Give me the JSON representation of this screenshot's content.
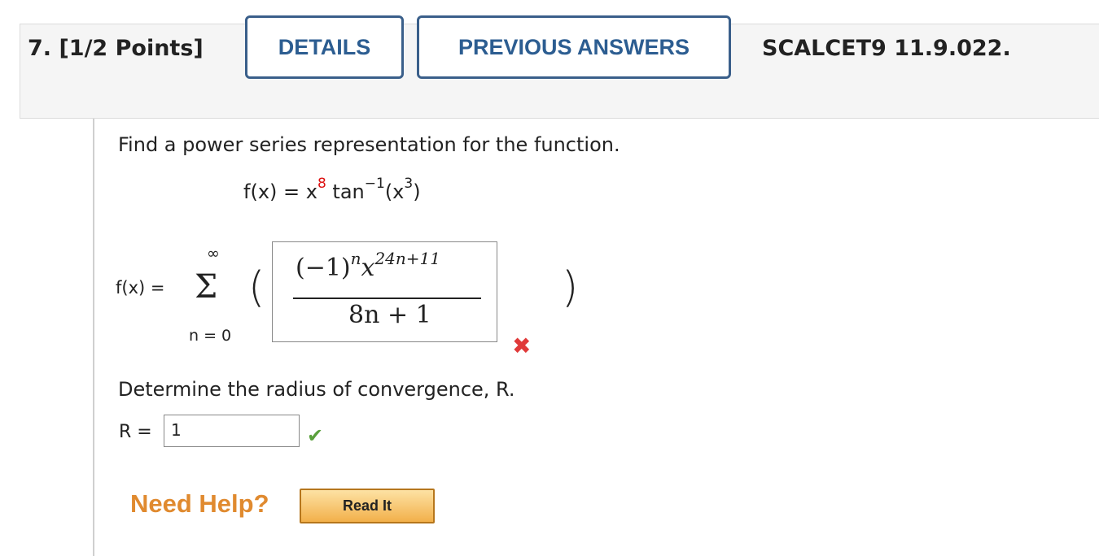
{
  "question": {
    "number_label": "7. [1/2 Points]",
    "details_button": "DETAILS",
    "previous_answers_button": "PREVIOUS ANSWERS",
    "code": "SCALCET9 11.9.022."
  },
  "problem": {
    "prompt": "Find a power series representation for the function.",
    "function_prefix": "f(x) = x",
    "function_exponent": "8",
    "function_tan": "tan",
    "function_tan_exp": "−1",
    "function_arg": "(x",
    "function_arg_exp": "3",
    "function_close": ")"
  },
  "series": {
    "lhs": "f(x) =",
    "upper_limit": "∞",
    "sigma": "Σ",
    "lower_limit": "n = 0",
    "answer_numerator_base": "(−1)",
    "answer_numerator_n": "n",
    "answer_numerator_x": "x",
    "answer_numerator_exp": "24n+11",
    "answer_denominator": "8n + 1",
    "status": "incorrect"
  },
  "radius": {
    "prompt": "Determine the radius of convergence, R.",
    "label": "R =",
    "value": "1",
    "status": "correct"
  },
  "help": {
    "label": "Need Help?",
    "read_it_button": "Read It"
  },
  "colors": {
    "button_border": "#3a5f8a",
    "button_text": "#2c5d91",
    "incorrect": "#e03a3a",
    "correct": "#5aa03c",
    "help_orange": "#e08a2f"
  }
}
